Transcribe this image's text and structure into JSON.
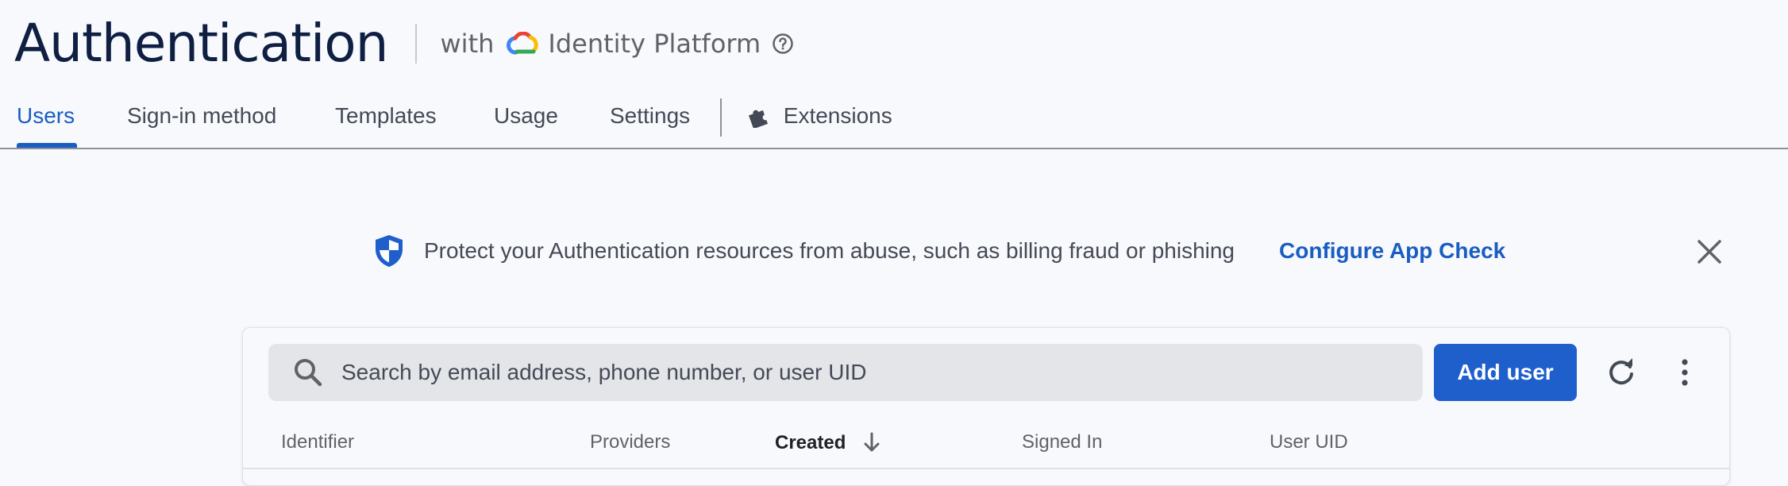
{
  "header": {
    "title": "Authentication",
    "with_label": "with",
    "platform_label": "Identity Platform"
  },
  "tabs": [
    {
      "label": "Users",
      "active": true
    },
    {
      "label": "Sign-in method",
      "active": false
    },
    {
      "label": "Templates",
      "active": false
    },
    {
      "label": "Usage",
      "active": false
    },
    {
      "label": "Settings",
      "active": false
    },
    {
      "label": "Extensions",
      "active": false
    }
  ],
  "banner": {
    "message": "Protect your Authentication resources from abuse, such as billing fraud or phishing",
    "link_label": "Configure App Check"
  },
  "users_table": {
    "search_placeholder": "Search by email address, phone number, or user UID",
    "add_user_label": "Add user",
    "columns": [
      {
        "label": "Identifier",
        "sorted": false
      },
      {
        "label": "Providers",
        "sorted": false
      },
      {
        "label": "Created",
        "sorted": true,
        "sort_direction": "descending"
      },
      {
        "label": "Signed In",
        "sorted": false
      },
      {
        "label": "User UID",
        "sorted": false
      }
    ]
  },
  "colors": {
    "accent": "#1a5dc2",
    "primary_button": "#1f5fcc",
    "title": "#0f1f42",
    "background": "#f8f9fd"
  },
  "icons": {
    "help": "help-circle-icon",
    "cloud": "google-cloud-icon",
    "extensions": "puzzle-piece-icon",
    "shield": "shield-icon",
    "close": "close-icon",
    "search": "search-icon",
    "refresh": "refresh-icon",
    "more": "more-vert-icon",
    "sort": "arrow-down-icon"
  }
}
